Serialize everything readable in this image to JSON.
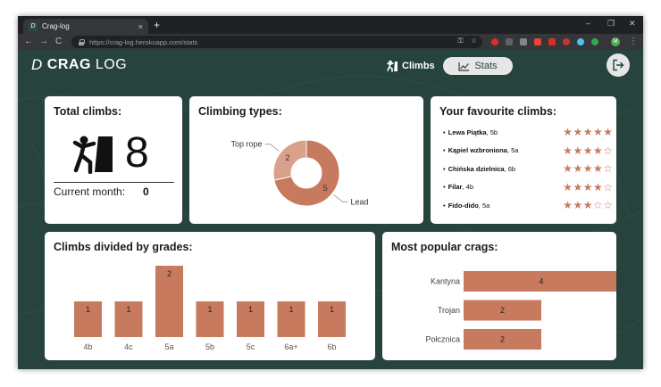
{
  "browser": {
    "tab_title": "Crag-log",
    "tab_close": "×",
    "new_tab": "+",
    "win_min": "–",
    "win_max": "❐",
    "win_close": "✕",
    "back": "←",
    "forward": "→",
    "reload": "C",
    "url": "https://crag-log.herokuapp.com/stats",
    "key_icon_glyph": "⚿",
    "star_icon_glyph": "☆",
    "menu_glyph": "⋮",
    "profile_initial": "M"
  },
  "app": {
    "logo_mark": "D",
    "logo_bold": "CRAG",
    "logo_light": "LOG",
    "nav_climbs": "Climbs",
    "nav_stats": "Stats",
    "accent": "#c77a5e",
    "bg": "#26433e"
  },
  "total": {
    "title": "Total climbs:",
    "count": "8",
    "current_month_label": "Current month:",
    "current_month_value": "0"
  },
  "types": {
    "title": "Climbing types:"
  },
  "favourites": {
    "title": "Your favourite climbs:",
    "items": [
      {
        "bullet": "•",
        "name": "Lewa Piątka",
        "grade": ", 5b",
        "stars": 5
      },
      {
        "bullet": "•",
        "name": "Kąpiel wzbroniona",
        "grade": ", 5a",
        "stars": 4
      },
      {
        "bullet": "•",
        "name": "Chińska dzielnica",
        "grade": ", 6b",
        "stars": 4
      },
      {
        "bullet": "•",
        "name": "Filar",
        "grade": ", 4b",
        "stars": 4
      },
      {
        "bullet": "•",
        "name": "Fido-dido",
        "grade": ", 5a",
        "stars": 3
      }
    ]
  },
  "grades": {
    "title": "Climbs divided by grades:"
  },
  "crags": {
    "title": "Most popular crags:"
  },
  "chart_data": [
    {
      "type": "pie",
      "title": "Climbing types:",
      "categories": [
        "Top rope",
        "Lead"
      ],
      "values": [
        2,
        5
      ],
      "colors": [
        "#d9a08a",
        "#c77a5e"
      ]
    },
    {
      "type": "bar",
      "title": "Climbs divided by grades:",
      "categories": [
        "4b",
        "4c",
        "5a",
        "5b",
        "5c",
        "6a+",
        "6b"
      ],
      "values": [
        1,
        1,
        2,
        1,
        1,
        1,
        1
      ],
      "ylim": [
        0,
        2
      ]
    },
    {
      "type": "bar",
      "orientation": "horizontal",
      "title": "Most popular crags:",
      "categories": [
        "Kantyna",
        "Trojan",
        "Połcznica"
      ],
      "values": [
        4,
        2,
        2
      ],
      "xlim": [
        0,
        4
      ]
    }
  ]
}
